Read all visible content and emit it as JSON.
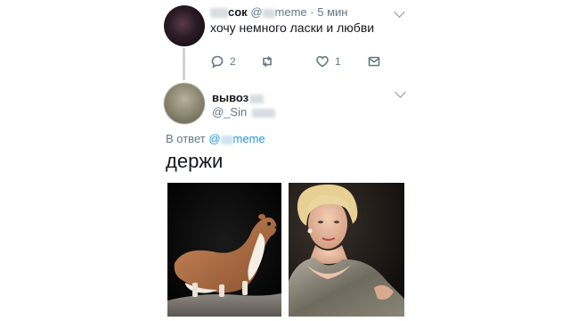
{
  "tweet1": {
    "name_visible": "сок",
    "handle_prefix": "@",
    "handle_visible": "meme",
    "separator": "·",
    "time": "5 мин",
    "text": "хочу немного ласки и любви",
    "actions": {
      "reply_count": "2",
      "retweet_count": "",
      "like_count": "1"
    }
  },
  "tweet2": {
    "name_visible": "вывоз",
    "handle_visible": "@_Sin",
    "reply_prefix": "В ответ",
    "reply_mention_prefix": "@",
    "reply_mention_visible": "meme",
    "text": "держи",
    "media": [
      {
        "icon": "weasel-photo"
      },
      {
        "icon": "woman-portrait-photo"
      }
    ]
  },
  "colors": {
    "link": "#1b95e0",
    "secondary_text": "#657786",
    "thread_line": "#c9d3dc"
  }
}
